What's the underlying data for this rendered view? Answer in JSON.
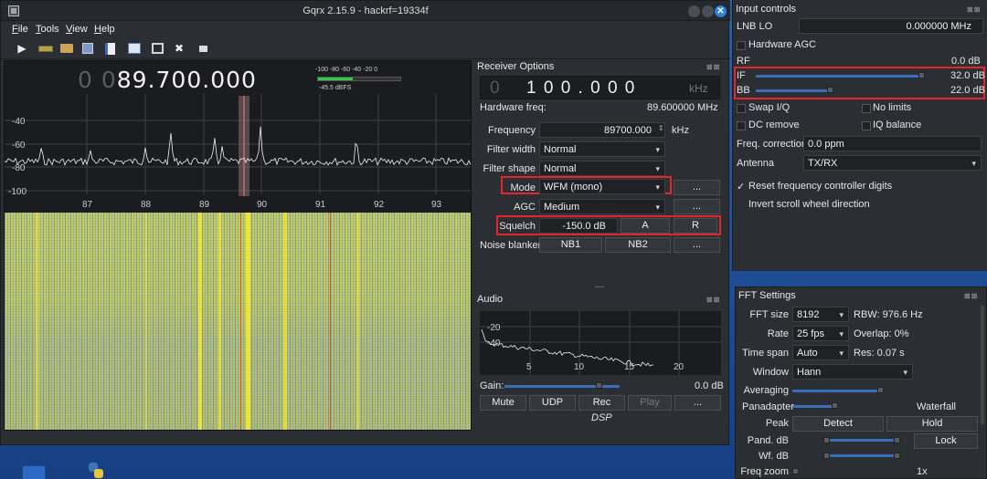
{
  "window": {
    "title": "Gqrx 2.15.9 - hackrf=19334f",
    "close_glyph": "✕"
  },
  "menu": [
    "File",
    "Tools",
    "View",
    "Help"
  ],
  "toolbar_icons": [
    "play-icon",
    "device-icon",
    "folder-icon",
    "save-icon",
    "document-icon",
    "waveform-icon",
    "remote-icon",
    "settings-icon",
    "dsp-icon"
  ],
  "plot": {
    "freq_dim": "0 0",
    "freq_main": "89.700.000",
    "meter_scale": "-100 -80 -60 -40 -20 0",
    "meter_value": "-45.5 dBFS",
    "meter_level": 0.42,
    "y_labels": [
      "-40",
      "-60",
      "-80",
      "-100"
    ],
    "x_labels": [
      "87",
      "88",
      "89",
      "90",
      "91",
      "92",
      "93"
    ]
  },
  "receiver": {
    "title": "Receiver Options",
    "lcd_dim": "0",
    "lcd_digits": "1 0 0 . 0 0 0",
    "lcd_unit": "kHz",
    "hw_freq_label": "Hardware freq:",
    "hw_freq_value": "89.600000 MHz",
    "frequency_label": "Frequency",
    "frequency_value": "89700.000",
    "frequency_unit": "kHz",
    "filter_width_label": "Filter width",
    "filter_width_value": "Normal",
    "filter_shape_label": "Filter shape",
    "filter_shape_value": "Normal",
    "mode_label": "Mode",
    "mode_value": "WFM (mono)",
    "agc_label": "AGC",
    "agc_value": "Medium",
    "squelch_label": "Squelch",
    "squelch_value": "-150.0 dB",
    "squelch_a": "A",
    "squelch_r": "R",
    "noise_blanker_label": "Noise blanker",
    "nb1": "NB1",
    "nb2": "NB2",
    "more": "...",
    "separator": "—"
  },
  "audio": {
    "title": "Audio",
    "y_labels": [
      "-20",
      "-40"
    ],
    "x_labels": [
      "5",
      "10",
      "15",
      "20"
    ],
    "gain_label": "Gain:",
    "gain_value": "0.0 dB",
    "gain_level": 0.82,
    "buttons": [
      "Mute",
      "UDP",
      "Rec",
      "Play",
      "..."
    ],
    "dsp_label": "DSP"
  },
  "input_controls": {
    "title": "Input controls",
    "lnb_label": "LNB LO",
    "lnb_value": "0.000000 MHz",
    "hw_agc_label": "Hardware AGC",
    "rf_label": "RF",
    "rf_value": "0.0 dB",
    "if_label": "IF",
    "if_value": "32.0 dB",
    "if_level": 0.8,
    "bb_label": "BB",
    "bb_value": "22.0 dB",
    "bb_level": 0.35,
    "swap_iq": "Swap I/Q",
    "no_limits": "No limits",
    "dc_remove": "DC remove",
    "iq_balance": "IQ balance",
    "freq_corr_label": "Freq. correction",
    "freq_corr_value": "0.0 ppm",
    "antenna_label": "Antenna",
    "antenna_value": "TX/RX",
    "reset_digits": "Reset frequency controller digits",
    "invert_scroll": "Invert scroll wheel direction",
    "checkmark": "✓"
  },
  "fft": {
    "title": "FFT Settings",
    "size_label": "FFT size",
    "size_value": "8192",
    "rbw": "RBW: 976.6 Hz",
    "rate_label": "Rate",
    "rate_value": "25 fps",
    "overlap": "Overlap: 0%",
    "timespan_label": "Time span",
    "timespan_value": "Auto",
    "res": "Res: 0.07 s",
    "window_label": "Window",
    "window_value": "Hann",
    "averaging_label": "Averaging",
    "panadapter_label": "Panadapter",
    "waterfall_label": "Waterfall",
    "peak_label": "Peak",
    "detect": "Detect",
    "hold": "Hold",
    "pand_db_label": "Pand. dB",
    "lock": "Lock",
    "wf_db_label": "Wf. dB",
    "freq_zoom_label": "Freq zoom",
    "zoom_value": "1x"
  },
  "panel_close": "⊠⊠"
}
